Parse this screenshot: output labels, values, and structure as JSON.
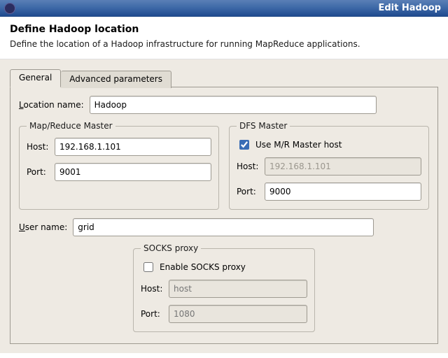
{
  "window": {
    "title": "Edit Hadoop"
  },
  "header": {
    "title": "Define Hadoop location",
    "subtitle": "Define the location of a Hadoop infrastructure for running MapReduce applications."
  },
  "tabs": {
    "general": "General",
    "advanced": "Advanced parameters"
  },
  "general": {
    "location_label_pre": "L",
    "location_label_post": "ocation name:",
    "location_value": "Hadoop",
    "mr_master": {
      "legend": "Map/Reduce Master",
      "host_label": "Host:",
      "host_value": "192.168.1.101",
      "port_label": "Port:",
      "port_value": "9001"
    },
    "dfs_master": {
      "legend": "DFS Master",
      "use_mr_label": "Use M/R Master host",
      "use_mr_checked": true,
      "host_label": "Host:",
      "host_value": "192.168.1.101",
      "port_label": "Port:",
      "port_value": "9000"
    },
    "user_label_pre": "U",
    "user_label_post": "ser name:",
    "user_value": "grid",
    "socks": {
      "legend": "SOCKS proxy",
      "enable_label": "Enable SOCKS proxy",
      "enable_checked": false,
      "host_label": "Host:",
      "host_placeholder": "host",
      "port_label": "Port:",
      "port_placeholder": "1080"
    }
  }
}
